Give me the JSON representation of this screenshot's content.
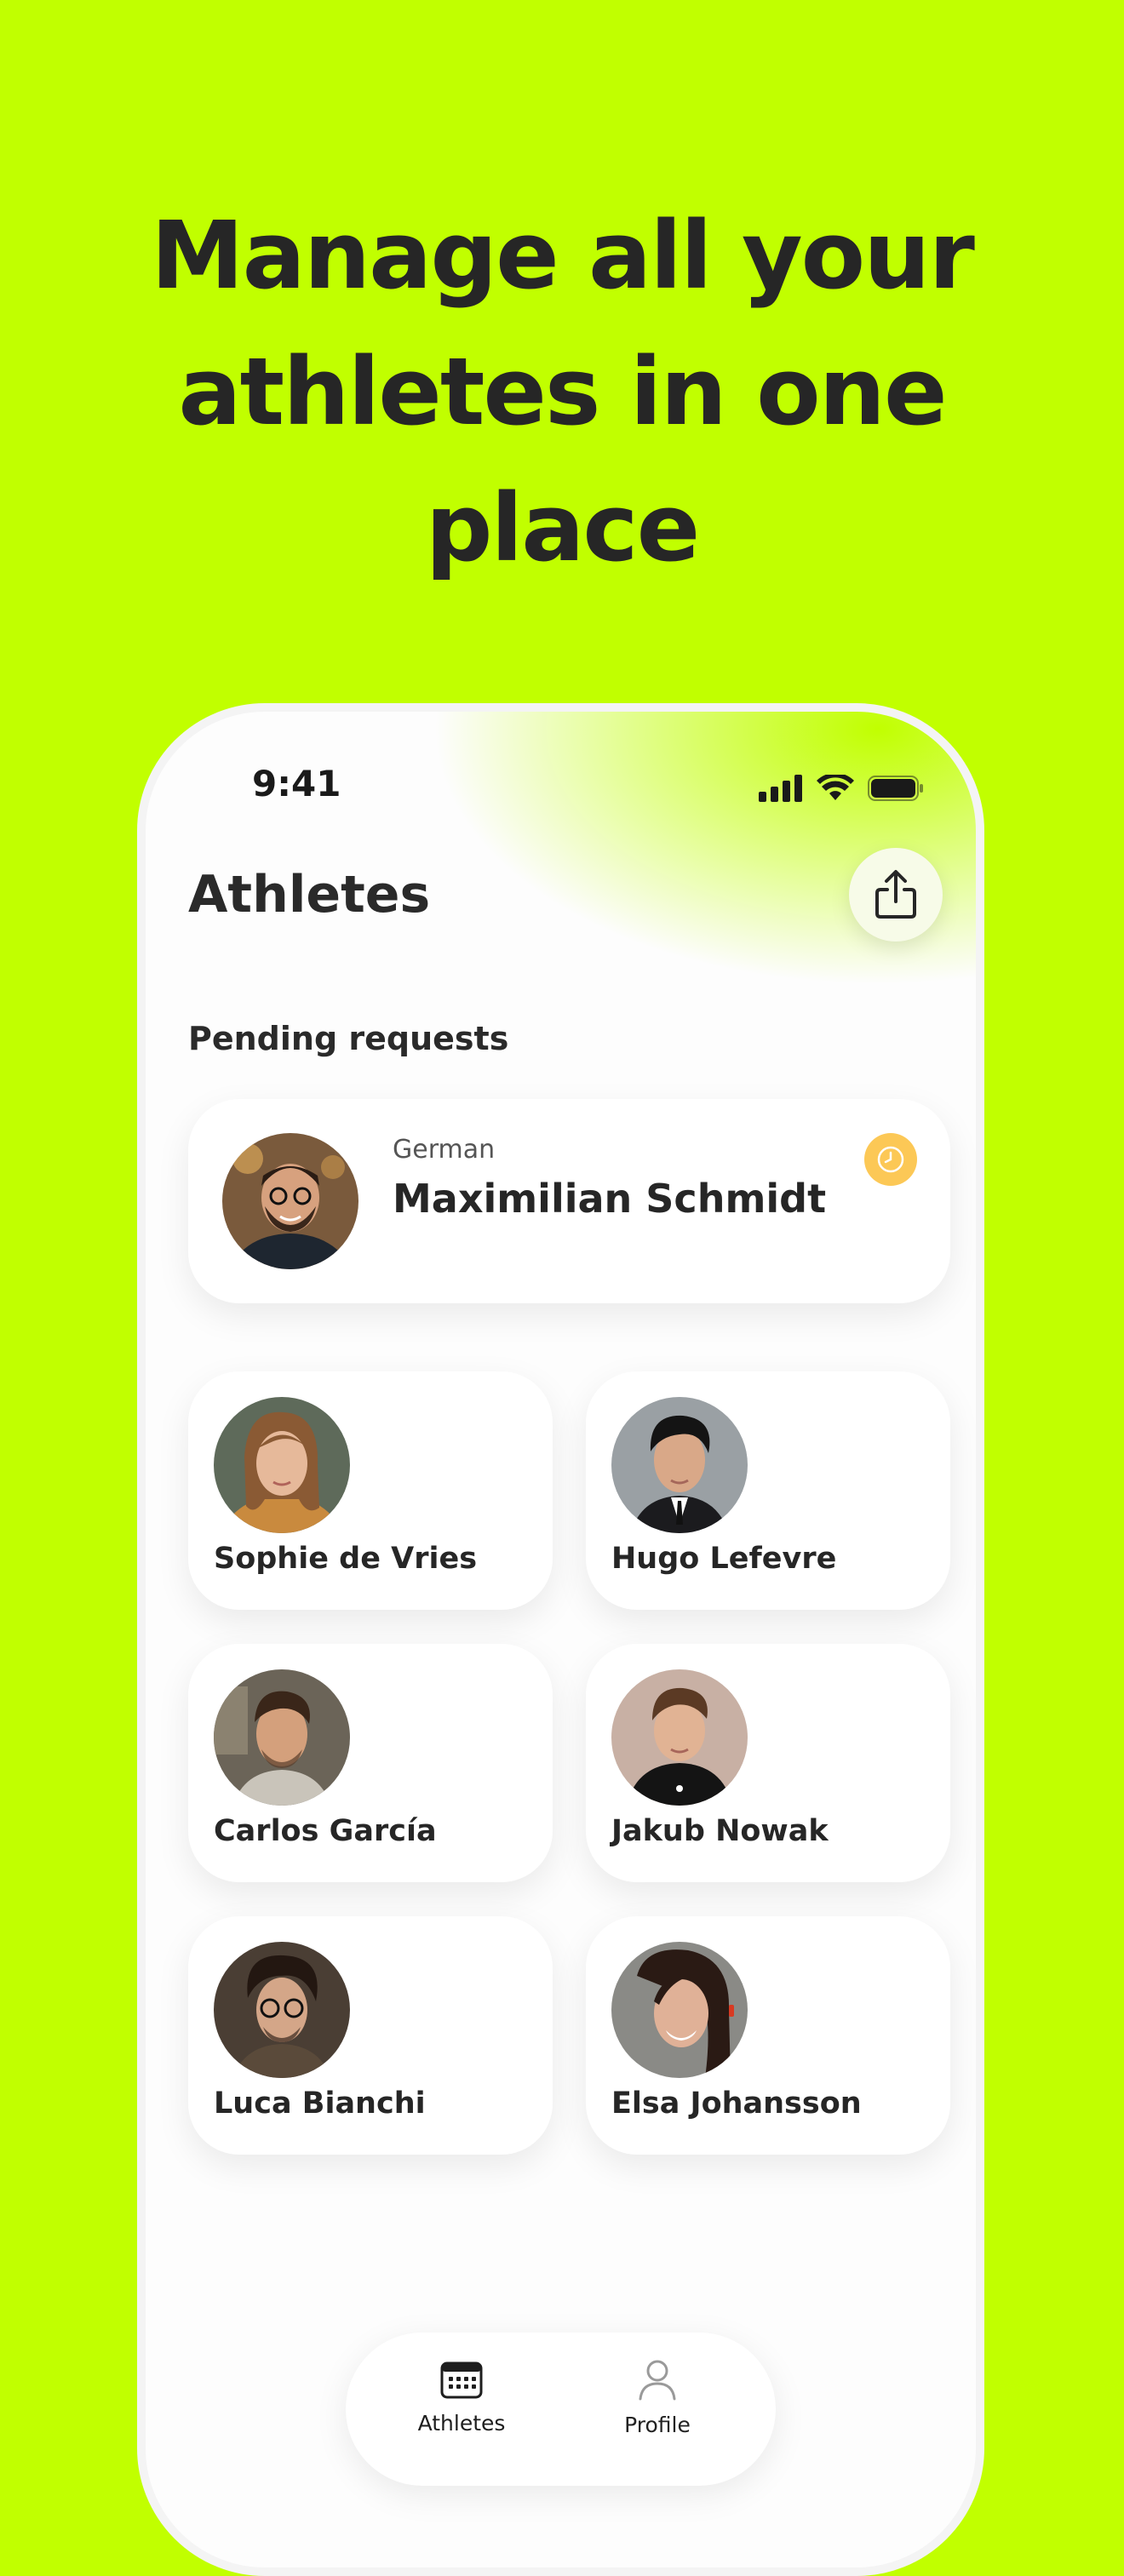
{
  "headline": {
    "line1": "Manage all your",
    "line2": "athletes in one",
    "line3": "place"
  },
  "status_bar": {
    "time": "9:41",
    "icons": [
      "cellular-signal-icon",
      "wifi-icon",
      "battery-icon"
    ]
  },
  "screen": {
    "title": "Athletes",
    "share_icon": "share-icon"
  },
  "pending": {
    "section_title": "Pending requests",
    "request": {
      "nationality": "German",
      "name": "Maximilian Schmidt",
      "status_icon": "clock-icon",
      "status_color": "#fcc856"
    }
  },
  "athletes": [
    {
      "name": "Sophie de Vries"
    },
    {
      "name": "Hugo Lefevre"
    },
    {
      "name": "Carlos García"
    },
    {
      "name": "Jakub Nowak"
    },
    {
      "name": "Luca Bianchi"
    },
    {
      "name": "Elsa Johansson"
    }
  ],
  "tab_bar": {
    "tabs": [
      {
        "label": "Athletes",
        "icon": "calendar-icon",
        "active": true
      },
      {
        "label": "Profile",
        "icon": "person-icon",
        "active": false
      }
    ]
  },
  "colors": {
    "background": "#c1ff00",
    "text": "#262626",
    "pending_badge": "#fcc856"
  }
}
